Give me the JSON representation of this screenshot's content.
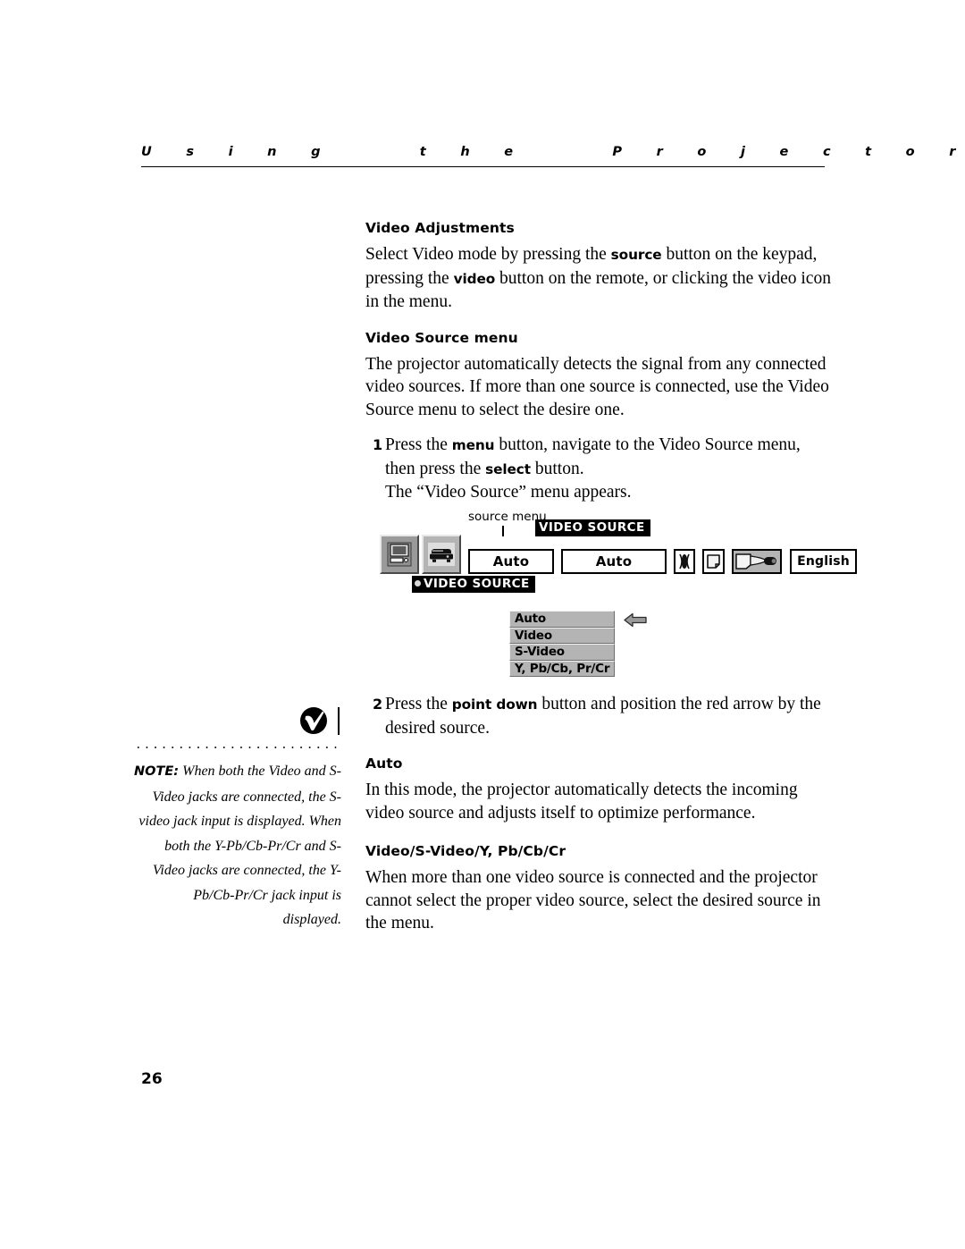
{
  "running_head": "U  s  i  n  g       t  h  e       P  r  o  j  e  c  t  o  r",
  "folio": "26",
  "main": {
    "section1_heading": "Video Adjustments",
    "section1_para_1a": "Select Video mode by pressing the ",
    "section1_para_bold1": "source",
    "section1_para_1b": " button on the keypad, pressing the ",
    "section1_para_bold2": "video",
    "section1_para_1c": " button on the remote, or clicking the video icon in the menu.",
    "section2_heading": "Video Source menu",
    "section2_para": "The projector automatically detects the signal from any connected video sources. If more than one source is connected, use the Video Source menu to select the desire one.",
    "step1_num": "1",
    "step1_a": "Press the ",
    "step1_bold1": "menu",
    "step1_b": " button, navigate to the Video Source menu, then press the ",
    "step1_bold2": "select",
    "step1_c": " button.",
    "step1_result": "The “Video Source” menu appears.",
    "step2_num": "2",
    "step2_a": "Press the ",
    "step2_bold1": "point down",
    "step2_b": " button and position the red arrow by the desired source.",
    "section3_heading": "Auto",
    "section3_para": "In this mode, the projector automatically detects the incoming video source and adjusts itself to optimize performance.",
    "section4_heading": "Video/S-Video/Y, Pb/Cb/Cr",
    "section4_para": "When more than one video source is connected and the projector cannot select the proper video source, select the desired source in the menu."
  },
  "note": {
    "label": "NOTE:",
    "text": " When both the Video and S-Video jacks are connected, the S-video jack input is displayed. When both the Y-Pb/Cb-Pr/Cr and S-Video jacks are connected, the Y-Pb/Cb-Pr/Cr jack input is displayed."
  },
  "figure": {
    "callout_label": "source menu",
    "tooltip_top": "VIDEO SOURCE",
    "tooltip_under": "VIDEO SOURCE",
    "icon_computer": "computer-source-icon",
    "icon_video": "video-source-icon",
    "field1_value": "Auto",
    "field2_value": "Auto",
    "icon_contrast": "contrast-icon",
    "icon_screen": "screen-icon",
    "icon_projection": "projection-mode-icon",
    "language_value": "English",
    "dropdown_options": [
      "Auto",
      "Video",
      "S-Video",
      "Y, Pb/Cb, Pr/Cr"
    ],
    "selected_option": "Auto",
    "arrow": "left-arrow-pointer",
    "colors": {
      "osd_face": "#b4b4b4",
      "osd_selected": "#9a9a9a",
      "tooltip_bg": "#000000",
      "tooltip_fg": "#ffffff",
      "field_bg": "#ffffff"
    }
  }
}
